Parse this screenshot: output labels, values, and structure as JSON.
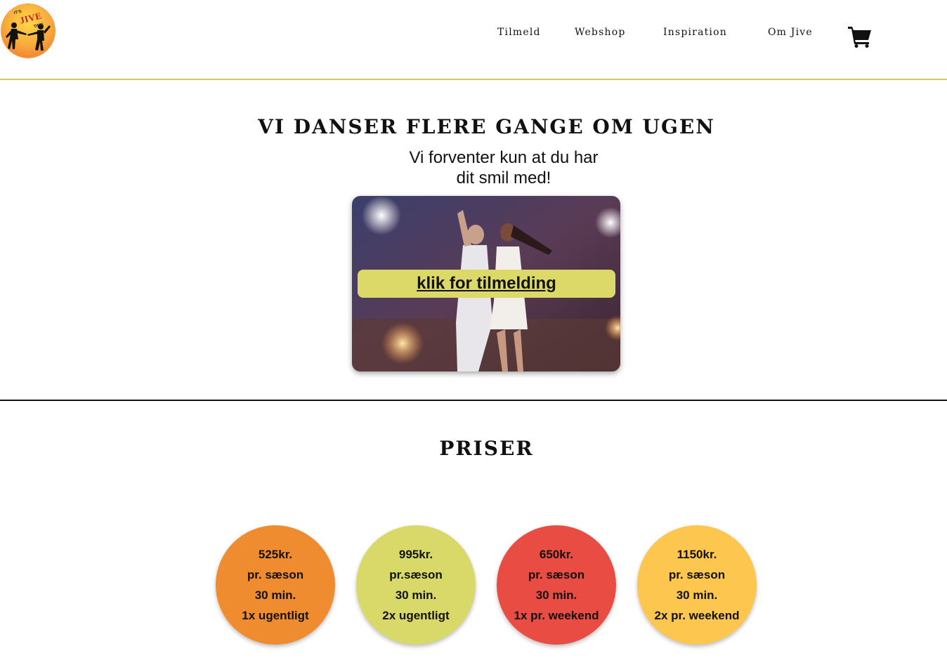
{
  "logo": {
    "line1": "IT'S",
    "main": "JIVE",
    "line2": "TIME"
  },
  "nav": {
    "items": [
      "Tilmeld",
      "Webshop",
      "Inspiration",
      "Om Jive"
    ],
    "cart_icon": "shopping-cart-icon"
  },
  "hero": {
    "title": "VI DANSER FLERE GANGE OM UGEN",
    "subtitle_line1": "Vi forventer kun at du har",
    "subtitle_line2": "dit smil med!",
    "cta_label": "klik for tilmelding"
  },
  "pricing": {
    "title": "PRISER",
    "plans": [
      {
        "price": "525kr.",
        "period": "pr. sæson",
        "duration": "30 min.",
        "frequency": "1x ugentligt",
        "color": "#f08c30"
      },
      {
        "price": "995kr.",
        "period": "pr.sæson",
        "duration": "30 min.",
        "frequency": "2x ugentligt",
        "color": "#d9d96a"
      },
      {
        "price": "650kr.",
        "period": "pr. sæson",
        "duration": "30 min.",
        "frequency": "1x pr. weekend",
        "color": "#e84c43"
      },
      {
        "price": "1150kr.",
        "period": "pr. sæson",
        "duration": "30 min.",
        "frequency": "2x pr. weekend",
        "color": "#fdc64f"
      }
    ]
  },
  "colors": {
    "header_border": "#d8c85a",
    "cta_bg": "#dcd968"
  }
}
